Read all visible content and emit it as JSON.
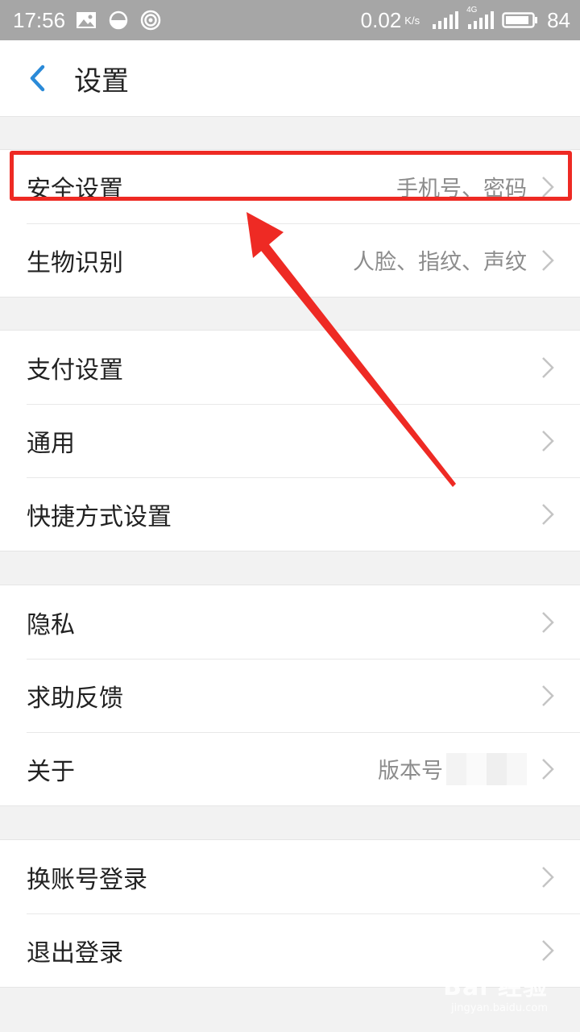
{
  "status_bar": {
    "time": "17:56",
    "speed": "0.02",
    "speed_unit": "K/s",
    "network_type": "4G",
    "battery": "84",
    "icons": [
      "image-icon",
      "data-saver-icon",
      "hotspot-icon",
      "signal-icon",
      "signal-4g-icon",
      "battery-icon"
    ]
  },
  "header": {
    "back_icon": "chevron-left-icon",
    "title": "设置",
    "accent_color": "#2a8ad8"
  },
  "groups": [
    {
      "items": [
        {
          "label": "安全设置",
          "value": "手机号、密码"
        },
        {
          "label": "生物识别",
          "value": "人脸、指纹、声纹"
        }
      ]
    },
    {
      "items": [
        {
          "label": "支付设置",
          "value": ""
        },
        {
          "label": "通用",
          "value": ""
        },
        {
          "label": "快捷方式设置",
          "value": ""
        }
      ]
    },
    {
      "items": [
        {
          "label": "隐私",
          "value": ""
        },
        {
          "label": "求助反馈",
          "value": ""
        },
        {
          "label": "关于",
          "value": "版本号"
        }
      ]
    },
    {
      "items": [
        {
          "label": "换账号登录",
          "value": ""
        },
        {
          "label": "退出登录",
          "value": ""
        }
      ]
    }
  ],
  "annotation": {
    "color": "#ee2a24",
    "highlighted_item": "安全设置"
  },
  "watermark": {
    "main": "Bai 经验",
    "sub": "jingyan.baidu.com"
  }
}
